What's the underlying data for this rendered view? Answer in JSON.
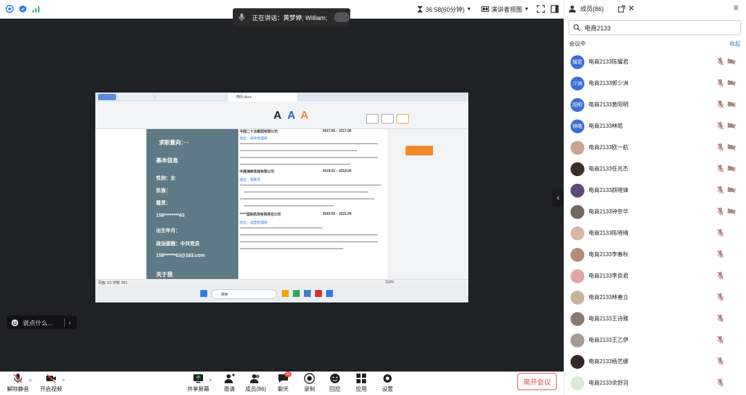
{
  "topbar": {
    "speaking_label": "正在讲话：黄梦婷; William;",
    "timer": "36:58(60分钟)",
    "view_mode": "演讲者视图"
  },
  "chat_input": {
    "placeholder": "说点什么..."
  },
  "bottombar": {
    "mute": "解除静音",
    "video": "开启视频",
    "share": "共享屏幕",
    "invite": "邀请",
    "members": "成员(86)",
    "chat": "聊天",
    "chat_badge": "11",
    "record": "录制",
    "reaction": "回应",
    "apps": "应用",
    "settings": "设置",
    "leave": "离开会议"
  },
  "panel": {
    "title": "成员(86)",
    "search_value": "电商2133",
    "section_label": "会议中",
    "collapse_label": "收起",
    "members": [
      {
        "name": "电商2133陈耀君",
        "avatar_text": "耀君",
        "avatar_color": "#3b6fd8",
        "mic_muted": true,
        "cam_off": true
      },
      {
        "name": "电商2133郭少洲",
        "avatar_text": "少洲",
        "avatar_color": "#3b6fd8",
        "mic_muted": true,
        "cam_off": true
      },
      {
        "name": "电商2133黄阳明",
        "avatar_text": "阳明",
        "avatar_color": "#3b6fd8",
        "mic_muted": true,
        "cam_off": true
      },
      {
        "name": "电商2133林皓",
        "avatar_text": "林皓",
        "avatar_color": "#3b6fd8",
        "mic_muted": true,
        "cam_off": true
      },
      {
        "name": "电商2133欧一航",
        "avatar_text": "",
        "avatar_color": "#c9a38f",
        "mic_muted": true,
        "cam_off": true
      },
      {
        "name": "电商2133任兆杰",
        "avatar_text": "",
        "avatar_color": "#3a2e2a",
        "mic_muted": true,
        "cam_off": true
      },
      {
        "name": "电商2133颜晓锋",
        "avatar_text": "",
        "avatar_color": "#5b4a7a",
        "mic_muted": true,
        "cam_off": true
      },
      {
        "name": "电商2133钟奈华",
        "avatar_text": "",
        "avatar_color": "#6f6a5e",
        "mic_muted": true,
        "cam_off": true
      },
      {
        "name": "电商2133陈晓晴",
        "avatar_text": "",
        "avatar_color": "#d8b7a8",
        "mic_muted": true,
        "cam_off": false
      },
      {
        "name": "电商2133李春秋",
        "avatar_text": "",
        "avatar_color": "#b38d74",
        "mic_muted": true,
        "cam_off": false
      },
      {
        "name": "电商2133李良君",
        "avatar_text": "",
        "avatar_color": "#e2a7a2",
        "mic_muted": true,
        "cam_off": false
      },
      {
        "name": "电商2133林春立",
        "avatar_text": "",
        "avatar_color": "#c7b49a",
        "mic_muted": true,
        "cam_off": false
      },
      {
        "name": "电商2133王诗雅",
        "avatar_text": "",
        "avatar_color": "#8c7a6e",
        "mic_muted": true,
        "cam_off": false
      },
      {
        "name": "电商2133王乙伊",
        "avatar_text": "",
        "avatar_color": "#a59b93",
        "mic_muted": true,
        "cam_off": false
      },
      {
        "name": "电商2133杨艺娜",
        "avatar_text": "",
        "avatar_color": "#2f2a27",
        "mic_muted": true,
        "cam_off": false
      },
      {
        "name": "电商2133余舒羽",
        "avatar_text": "",
        "avatar_color": "#d9ead3",
        "mic_muted": true,
        "cam_off": false
      }
    ]
  },
  "shared_doc": {
    "tab_active": "简历.docx",
    "left": {
      "job_intent": "求职意向：···",
      "basic_info": "基本信息",
      "gender": "性别：女",
      "ethnicity": "民族：",
      "origin": "籍贯：",
      "phone": "158********63",
      "birth": "出生年月：",
      "politics": "政治面貌：中共党员",
      "email": "158******63@163.com",
      "about": "关于我"
    },
    "page": {
      "company1": "中国二十冶集团有限公司",
      "period1": "2017.06 – 2017.08",
      "role1": "岗位：商务管理岗",
      "c2": "中建海峡发展有限公司",
      "p2": "2019.01 – 2019.04",
      "r2": "岗位：预算员",
      "c3": "*****国际机场有限责任公司",
      "p3": "2020.09 – 2021.09",
      "r3": "岗位：运营管理岗"
    },
    "search_placeholder": "搜索",
    "status_left": "页面: 1/1  字数: 961",
    "zoom": "110%"
  }
}
